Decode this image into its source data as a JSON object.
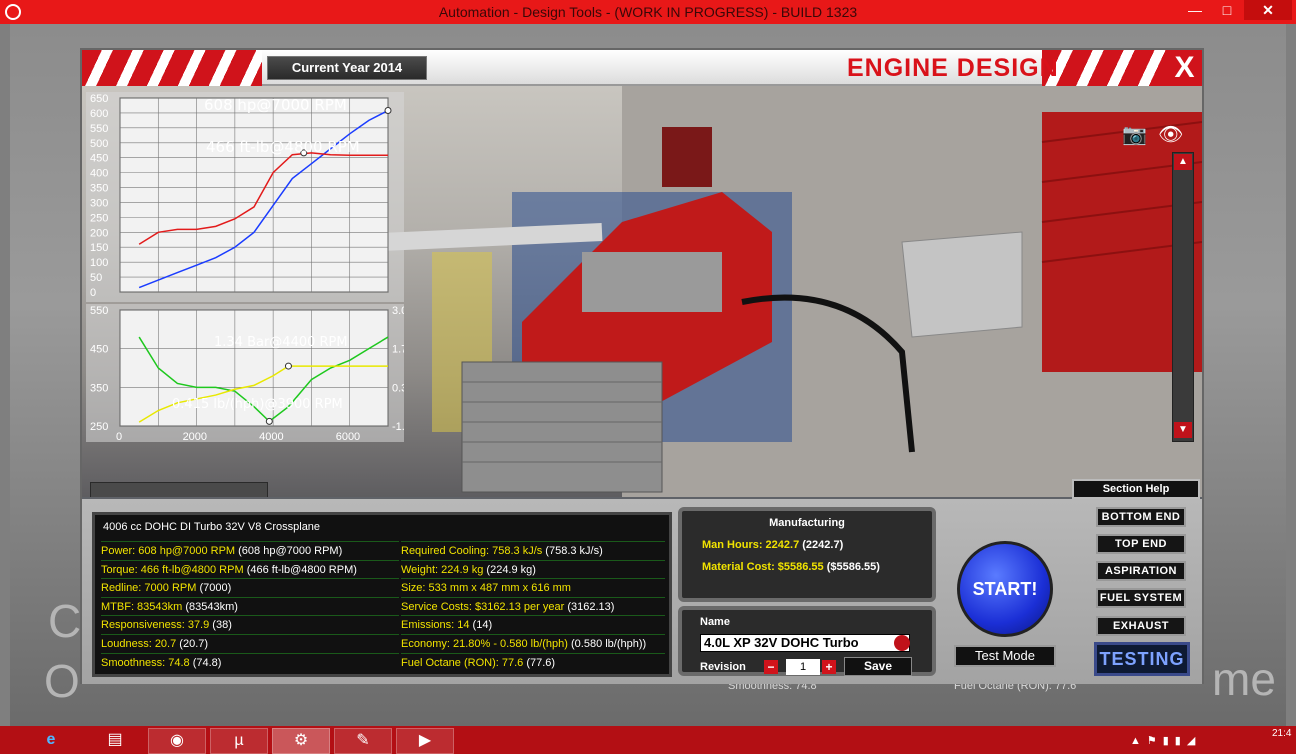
{
  "window": {
    "title": "Automation - Design Tools - (WORK IN PROGRESS) - BUILD 1323",
    "minimize": "—",
    "maximize": "□",
    "close": "✕"
  },
  "header": {
    "current_year": "Current Year 2014",
    "title": "ENGINE DESIGN",
    "close_label": "X"
  },
  "chart_data": [
    {
      "type": "line",
      "annotations": [
        "608 hp@7000 RPM",
        "466 ft-lb@4800 RPM"
      ],
      "ylim": [
        0,
        650
      ],
      "yticks": [
        "650",
        "600",
        "550",
        "500",
        "450",
        "400",
        "350",
        "300",
        "250",
        "200",
        "150",
        "100",
        "50",
        "0"
      ],
      "series": [
        {
          "color": "#1a3cff",
          "x": [
            500,
            1000,
            1500,
            2000,
            2500,
            3000,
            3500,
            4000,
            4500,
            5000,
            5500,
            6000,
            6500,
            7000
          ],
          "values": [
            15,
            40,
            65,
            90,
            115,
            150,
            200,
            290,
            380,
            430,
            480,
            530,
            575,
            608
          ]
        },
        {
          "color": "#e21b1b",
          "x": [
            500,
            1000,
            1500,
            2000,
            2500,
            3000,
            3500,
            4000,
            4500,
            5000,
            5500,
            6000,
            6500,
            7000
          ],
          "values": [
            160,
            200,
            210,
            210,
            220,
            245,
            285,
            400,
            460,
            466,
            460,
            458,
            458,
            458
          ]
        }
      ]
    },
    {
      "type": "line",
      "annotations": [
        "1.34 Bar@4400 RPM",
        "0.415 lb/(hph)@3900 RPM"
      ],
      "ylim": [
        250,
        550
      ],
      "yticks": [
        "550",
        "450",
        "350",
        "250"
      ],
      "y2ticks": [
        "3.0",
        "1.7",
        "0.3",
        "-1.0"
      ],
      "xticks": [
        "0",
        "2000",
        "4000",
        "6000"
      ],
      "series": [
        {
          "color": "#1ec81e",
          "x": [
            500,
            1000,
            1500,
            2000,
            2500,
            3000,
            3500,
            3900,
            4400,
            5000,
            5500,
            6000,
            6500,
            7000
          ],
          "values": [
            480,
            400,
            360,
            350,
            350,
            340,
            300,
            262,
            300,
            370,
            400,
            420,
            450,
            480
          ]
        },
        {
          "color": "#e8e800",
          "x": [
            500,
            1000,
            1500,
            2000,
            2500,
            3000,
            3500,
            4000,
            4400,
            5000,
            5500,
            6000,
            6500,
            7000
          ],
          "values": [
            260,
            290,
            310,
            320,
            330,
            345,
            355,
            380,
            405,
            405,
            405,
            405,
            405,
            405
          ]
        }
      ]
    }
  ],
  "stats": {
    "heading": "4006 cc DOHC DI Turbo 32V V8 Crossplane",
    "left": [
      {
        "label": "Power: 608 hp@7000 RPM",
        "extra": "(608 hp@7000 RPM)"
      },
      {
        "label": "Torque: 466 ft-lb@4800 RPM",
        "extra": "(466 ft-lb@4800 RPM)"
      },
      {
        "label": "Redline: 7000 RPM",
        "extra": "(7000)"
      },
      {
        "label": "MTBF: 83543km",
        "extra": "(83543km)"
      },
      {
        "label": "Responsiveness: 37.9",
        "extra": "(38)"
      },
      {
        "label": "Loudness: 20.7",
        "extra": "(20.7)"
      },
      {
        "label": "Smoothness: 74.8",
        "extra": "(74.8)"
      }
    ],
    "right": [
      {
        "label": "Required Cooling: 758.3 kJ/s",
        "extra": "(758.3 kJ/s)"
      },
      {
        "label": "Weight: 224.9 kg",
        "extra": "(224.9 kg)"
      },
      {
        "label": "Size: 533 mm x 487 mm x 616 mm",
        "extra": ""
      },
      {
        "label": "Service Costs: $3162.13 per year",
        "extra": "(3162.13)"
      },
      {
        "label": "Emissions: 14",
        "extra": "(14)"
      },
      {
        "label": "Economy: 21.80% - 0.580 lb/(hph)",
        "extra": "(0.580 lb/(hph))"
      },
      {
        "label": "Fuel Octane (RON): 77.6",
        "extra": "(77.6)"
      }
    ]
  },
  "manufacturing": {
    "title": "Manufacturing",
    "man_hours_label": "Man Hours: 2242.7",
    "man_hours_extra": "(2242.7)",
    "material_label": "Material Cost: $5586.55",
    "material_extra": "($5586.55)"
  },
  "naming": {
    "name_label": "Name",
    "name_value": "4.0L XP 32V DOHC Turbo",
    "revision_label": "Revision",
    "revision_value": "1",
    "minus": "−",
    "plus": "+",
    "save_label": "Save"
  },
  "actions": {
    "start_label": "START!",
    "test_mode_label": "Test Mode",
    "section_help_label": "Section Help"
  },
  "nav": {
    "items": [
      "BOTTOM END",
      "TOP END",
      "ASPIRATION",
      "FUEL SYSTEM",
      "EXHAUST"
    ],
    "testing_label": "TESTING"
  },
  "background": {
    "left_text_1": "C",
    "left_text_2": "O",
    "right_text": "me",
    "under_smoothness": "Smoothness: 74.8",
    "under_octane": "Fuel Octane (RON): 77.6"
  },
  "taskbar": {
    "clock": "21:4"
  }
}
